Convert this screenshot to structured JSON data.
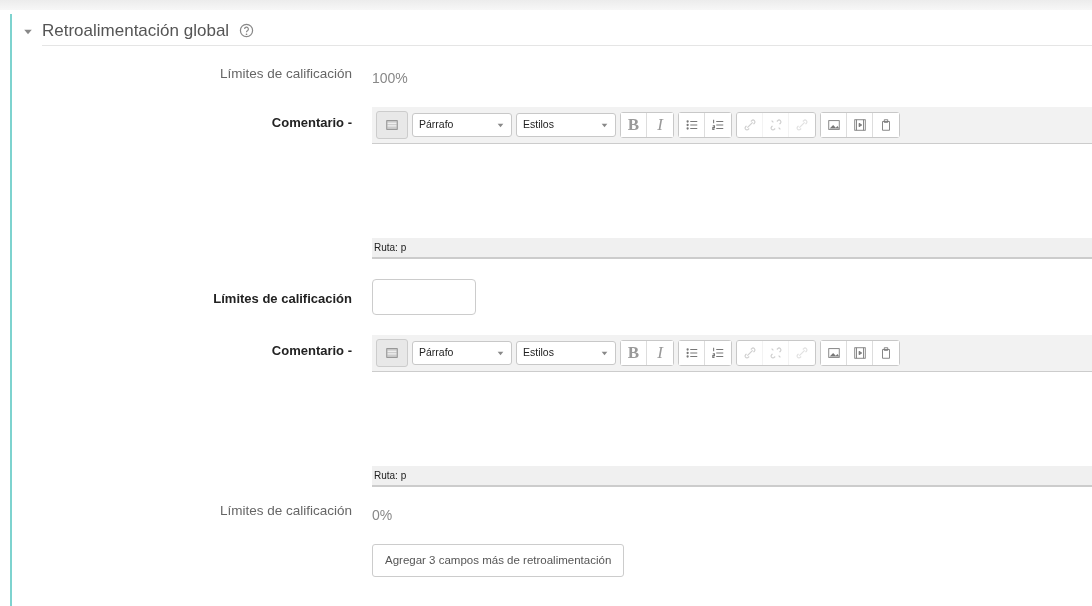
{
  "section": {
    "title": "Retroalimentación global",
    "expanded": true
  },
  "rows": [
    {
      "kind": "static",
      "label": "Límites de calificación",
      "value": "100%"
    },
    {
      "kind": "editor",
      "label": "Comentario -",
      "format": "Párrafo",
      "styles": "Estilos",
      "path": "Ruta: p",
      "tools": [
        [
          {
            "kind": "toggle",
            "disabled": false
          }
        ],
        [
          {
            "kind": "text",
            "text": "B",
            "disabled": false
          },
          {
            "kind": "text",
            "text": "I",
            "disabled": false
          }
        ],
        [
          {
            "kind": "bullets",
            "disabled": false
          },
          {
            "kind": "numbers",
            "disabled": false
          }
        ],
        [
          {
            "kind": "link",
            "disabled": true
          },
          {
            "kind": "unlink",
            "disabled": true
          },
          {
            "kind": "anchor",
            "disabled": true
          }
        ],
        [
          {
            "kind": "image",
            "disabled": false
          },
          {
            "kind": "media",
            "disabled": false
          },
          {
            "kind": "paste",
            "disabled": false
          }
        ]
      ]
    },
    {
      "kind": "input",
      "label": "Límites de calificación"
    },
    {
      "kind": "editor",
      "label": "Comentario -",
      "format": "Párrafo",
      "styles": "Estilos",
      "path": "Ruta: p",
      "tools": [
        [
          {
            "kind": "toggle",
            "disabled": false
          }
        ],
        [
          {
            "kind": "text",
            "text": "B",
            "disabled": false
          },
          {
            "kind": "text",
            "text": "I",
            "disabled": false
          }
        ],
        [
          {
            "kind": "bullets",
            "disabled": false
          },
          {
            "kind": "numbers",
            "disabled": false
          }
        ],
        [
          {
            "kind": "link",
            "disabled": true
          },
          {
            "kind": "unlink",
            "disabled": true
          },
          {
            "kind": "anchor",
            "disabled": true
          }
        ],
        [
          {
            "kind": "image",
            "disabled": false
          },
          {
            "kind": "media",
            "disabled": false
          },
          {
            "kind": "paste",
            "disabled": false
          }
        ]
      ]
    },
    {
      "kind": "static",
      "label": "Límites de calificación",
      "value": "0%"
    },
    {
      "kind": "button",
      "text": "Agregar 3 campos más de retroalimentación"
    }
  ]
}
